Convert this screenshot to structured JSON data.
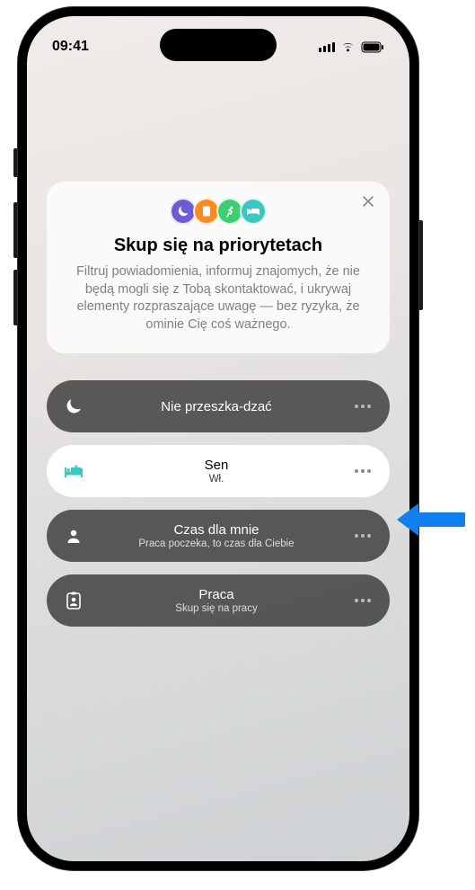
{
  "status": {
    "time": "09:41"
  },
  "intro": {
    "title": "Skup się na priorytetach",
    "desc": "Filtruj powiadomienia, informuj znajomych, że nie będą mogli się z Tobą skontaktować, i ukrywaj elementy rozpraszające uwagę — bez ryzyka, że ominie Cię coś ważnego."
  },
  "focus": {
    "items": [
      {
        "label": "Nie przeszka-dzać",
        "sub": ""
      },
      {
        "label": "Sen",
        "sub": "Wł."
      },
      {
        "label": "Czas dla mnie",
        "sub": "Praca poczeka, to czas dla Ciebie"
      },
      {
        "label": "Praca",
        "sub": "Skup się na pracy"
      }
    ]
  }
}
